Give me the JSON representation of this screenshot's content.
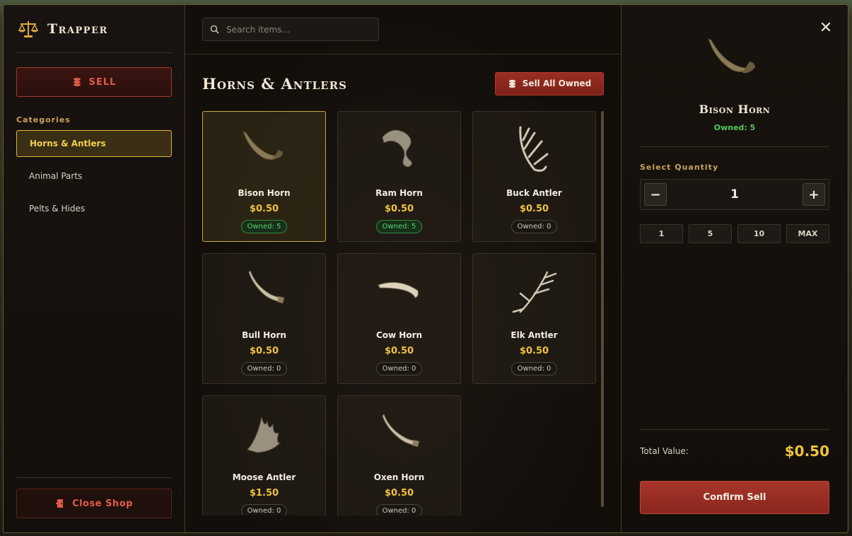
{
  "app": {
    "title": "Trapper",
    "brand_icon": "balance-scale-icon"
  },
  "sidebar": {
    "sell_label": "SELL",
    "categories_label": "Categories",
    "categories": [
      {
        "label": "Horns & Antlers",
        "active": true
      },
      {
        "label": "Animal Parts",
        "active": false
      },
      {
        "label": "Pelts & Hides",
        "active": false
      }
    ],
    "close_label": "Close Shop"
  },
  "search": {
    "placeholder": "Search items...",
    "value": ""
  },
  "main": {
    "section_title": "Horns & Antlers",
    "sell_all_label": "Sell All Owned",
    "items": [
      {
        "name": "Bison Horn",
        "price": "$0.50",
        "owned": "Owned: 5",
        "has": true,
        "selected": true,
        "icon": "bison-horn-icon"
      },
      {
        "name": "Ram Horn",
        "price": "$0.50",
        "owned": "Owned: 5",
        "has": true,
        "selected": false,
        "icon": "ram-horn-icon"
      },
      {
        "name": "Buck Antler",
        "price": "$0.50",
        "owned": "Owned: 0",
        "has": false,
        "selected": false,
        "icon": "buck-antler-icon"
      },
      {
        "name": "Bull Horn",
        "price": "$0.50",
        "owned": "Owned: 0",
        "has": false,
        "selected": false,
        "icon": "bull-horn-icon"
      },
      {
        "name": "Cow Horn",
        "price": "$0.50",
        "owned": "Owned: 0",
        "has": false,
        "selected": false,
        "icon": "cow-horn-icon"
      },
      {
        "name": "Elk Antler",
        "price": "$0.50",
        "owned": "Owned: 0",
        "has": false,
        "selected": false,
        "icon": "elk-antler-icon"
      },
      {
        "name": "Moose Antler",
        "price": "$1.50",
        "owned": "Owned: 0",
        "has": false,
        "selected": false,
        "icon": "moose-antler-icon"
      },
      {
        "name": "Oxen Horn",
        "price": "$0.50",
        "owned": "Owned: 0",
        "has": false,
        "selected": false,
        "icon": "oxen-horn-icon"
      }
    ]
  },
  "detail": {
    "name": "Bison Horn",
    "owned": "Owned: 5",
    "quantity_label": "Select Quantity",
    "quantity": "1",
    "presets": [
      "1",
      "5",
      "10",
      "MAX"
    ],
    "total_label": "Total Value:",
    "total_value": "$0.50",
    "confirm_label": "Confirm Sell"
  },
  "colors": {
    "accent_gold": "#f0c33a",
    "accent_red": "#a8352a",
    "owned_green": "#4fc85e",
    "border_gold": "#c9a54a"
  }
}
